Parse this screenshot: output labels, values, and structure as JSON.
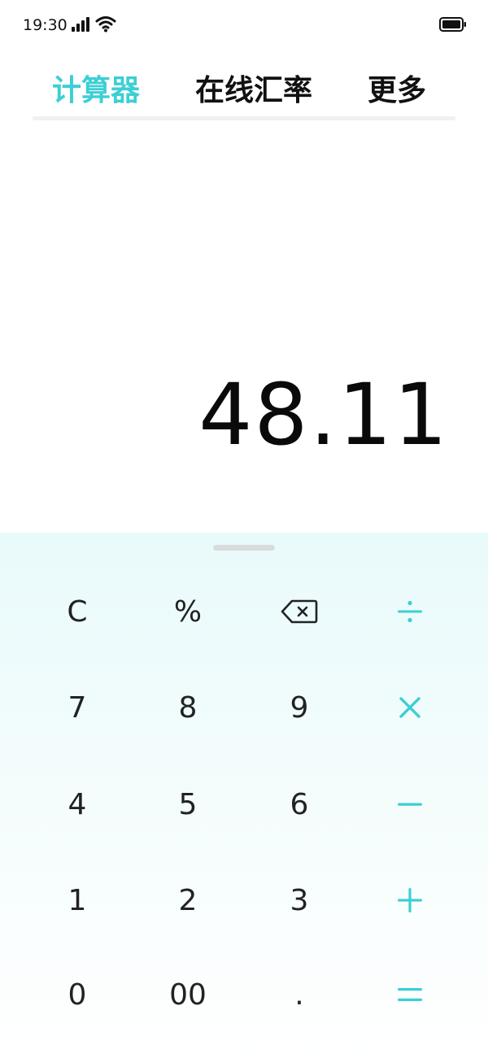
{
  "status_bar": {
    "time": "19:30",
    "icons": [
      "signal-icon",
      "wifi-icon",
      "battery-icon"
    ]
  },
  "tabs": [
    {
      "label": "计算器",
      "active": true
    },
    {
      "label": "在线汇率",
      "active": false
    },
    {
      "label": "更多",
      "active": false
    }
  ],
  "display": {
    "value": "48.11"
  },
  "keypad": {
    "keys": {
      "clear": "C",
      "percent": "%",
      "backspace": "backspace-icon",
      "divide": "÷",
      "seven": "7",
      "eight": "8",
      "nine": "9",
      "multiply": "×",
      "four": "4",
      "five": "5",
      "six": "6",
      "minus": "−",
      "one": "1",
      "two": "2",
      "three": "3",
      "plus": "+",
      "zero": "0",
      "double_zero": "00",
      "decimal": ".",
      "equals": "="
    }
  },
  "colors": {
    "accent": "#3ccfd4",
    "text": "#111111",
    "keypad_background": "#e9fafb"
  }
}
